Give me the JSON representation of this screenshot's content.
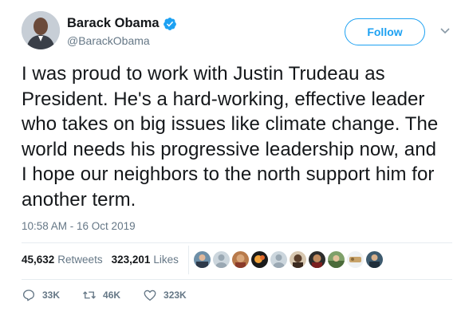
{
  "author": {
    "display_name": "Barack Obama",
    "handle": "@BarackObama",
    "verified_icon": "verified-badge-icon",
    "verified_color": "#1da1f2"
  },
  "follow_button": {
    "label": "Follow",
    "color": "#1da1f2"
  },
  "tweet": {
    "text": "I was proud to work with Justin Trudeau as President. He's a hard-working, effective leader who takes on big issues like climate change. The world needs his progressive leadership now, and I hope our neighbors to the north support him for another term.",
    "timestamp": "10:58 AM - 16 Oct 2019"
  },
  "stats": {
    "retweets_count": "45,632",
    "retweets_label": "Retweets",
    "likes_count": "323,201",
    "likes_label": "Likes",
    "liker_avatars": 10
  },
  "actions": {
    "reply": {
      "icon": "reply-icon",
      "count": "33K"
    },
    "retweet": {
      "icon": "retweet-icon",
      "count": "46K"
    },
    "like": {
      "icon": "heart-icon",
      "count": "323K"
    }
  },
  "colors": {
    "text": "#14171a",
    "muted": "#657786",
    "divider": "#e6ecf0"
  }
}
